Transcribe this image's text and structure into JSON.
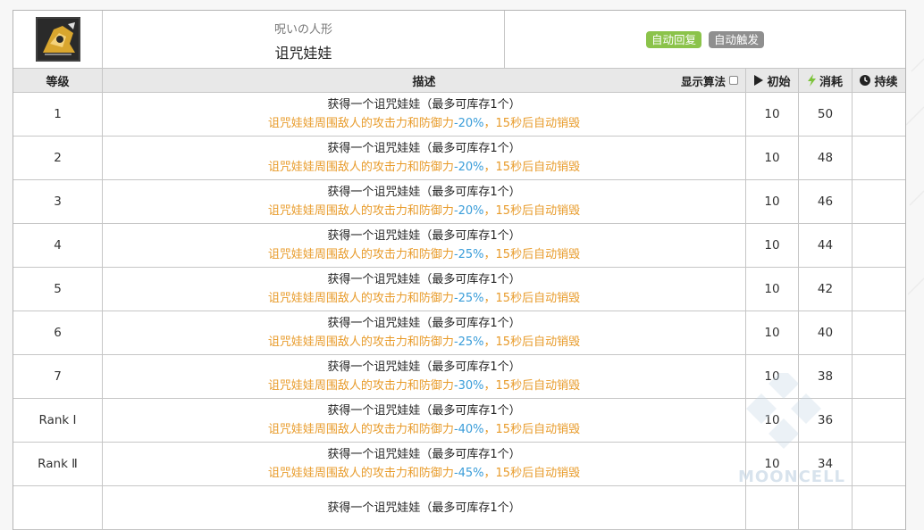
{
  "skill": {
    "name_jp": "呪いの人形",
    "name_cn": "诅咒娃娃",
    "icon": "cursed-doll-icon",
    "tags": [
      {
        "label": "自动回复",
        "color": "#8bc34a"
      },
      {
        "label": "自动触发",
        "color": "#8f8f8f"
      }
    ]
  },
  "columns": {
    "level": "等级",
    "desc": "描述",
    "show_algo": "显示算法",
    "init": "初始",
    "cost": "消耗",
    "dur": "持续"
  },
  "rows": [
    {
      "level": "1",
      "line1": "获得一个诅咒娃娃（最多可库存1个）",
      "pre": "诅咒娃娃周围敌人的攻击力和防御力",
      "pct": "-20%",
      "post": "，15秒后自动销毁",
      "init": "10",
      "cost": "50",
      "dur": ""
    },
    {
      "level": "2",
      "line1": "获得一个诅咒娃娃（最多可库存1个）",
      "pre": "诅咒娃娃周围敌人的攻击力和防御力",
      "pct": "-20%",
      "post": "，15秒后自动销毁",
      "init": "10",
      "cost": "48",
      "dur": ""
    },
    {
      "level": "3",
      "line1": "获得一个诅咒娃娃（最多可库存1个）",
      "pre": "诅咒娃娃周围敌人的攻击力和防御力",
      "pct": "-20%",
      "post": "，15秒后自动销毁",
      "init": "10",
      "cost": "46",
      "dur": ""
    },
    {
      "level": "4",
      "line1": "获得一个诅咒娃娃（最多可库存1个）",
      "pre": "诅咒娃娃周围敌人的攻击力和防御力",
      "pct": "-25%",
      "post": "，15秒后自动销毁",
      "init": "10",
      "cost": "44",
      "dur": ""
    },
    {
      "level": "5",
      "line1": "获得一个诅咒娃娃（最多可库存1个）",
      "pre": "诅咒娃娃周围敌人的攻击力和防御力",
      "pct": "-25%",
      "post": "，15秒后自动销毁",
      "init": "10",
      "cost": "42",
      "dur": ""
    },
    {
      "level": "6",
      "line1": "获得一个诅咒娃娃（最多可库存1个）",
      "pre": "诅咒娃娃周围敌人的攻击力和防御力",
      "pct": "-25%",
      "post": "，15秒后自动销毁",
      "init": "10",
      "cost": "40",
      "dur": ""
    },
    {
      "level": "7",
      "line1": "获得一个诅咒娃娃（最多可库存1个）",
      "pre": "诅咒娃娃周围敌人的攻击力和防御力",
      "pct": "-30%",
      "post": "，15秒后自动销毁",
      "init": "10",
      "cost": "38",
      "dur": ""
    },
    {
      "level": "Rank Ⅰ",
      "line1": "获得一个诅咒娃娃（最多可库存1个）",
      "pre": "诅咒娃娃周围敌人的攻击力和防御力",
      "pct": "-40%",
      "post": "，15秒后自动销毁",
      "init": "10",
      "cost": "36",
      "dur": ""
    },
    {
      "level": "Rank Ⅱ",
      "line1": "获得一个诅咒娃娃（最多可库存1个）",
      "pre": "诅咒娃娃周围敌人的攻击力和防御力",
      "pct": "-45%",
      "post": "，15秒后自动销毁",
      "init": "10",
      "cost": "34",
      "dur": ""
    },
    {
      "level": "",
      "line1": "获得一个诅咒娃娃（最多可库存1个）",
      "pre": "",
      "pct": "",
      "post": "",
      "init": "",
      "cost": "",
      "dur": ""
    }
  ],
  "watermark": "MOONCELL",
  "colors": {
    "highlight_text": "#e89b2a",
    "percent": "#3a9dd9",
    "header_bg": "#e8e8e8"
  }
}
